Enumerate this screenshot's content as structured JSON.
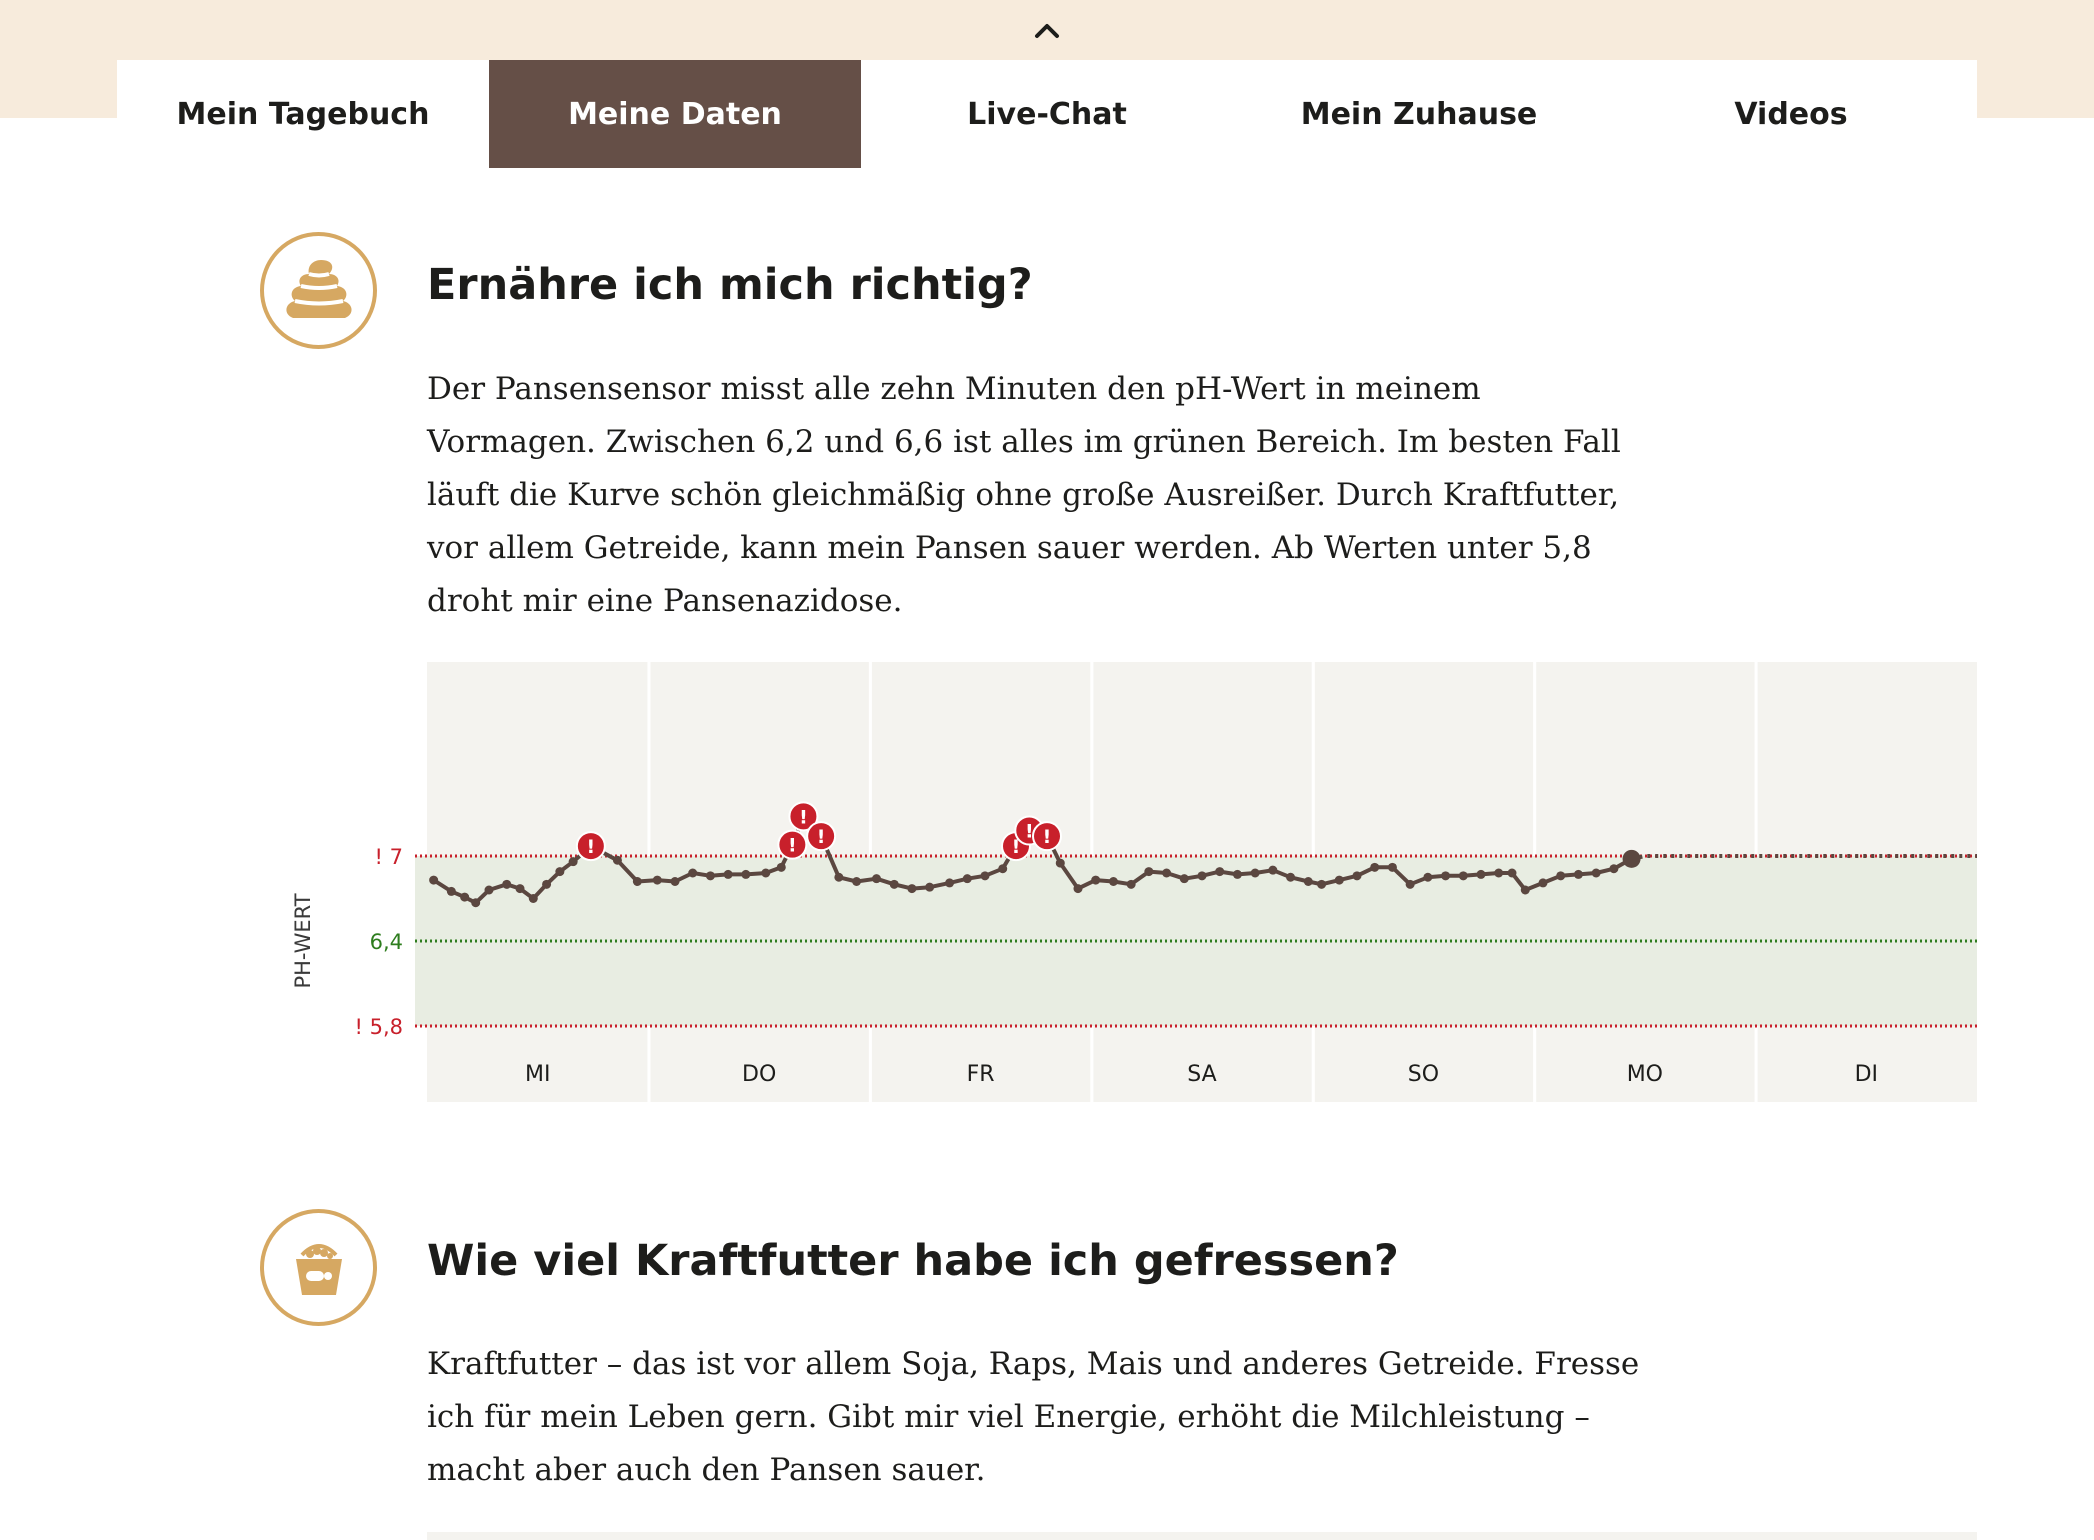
{
  "nav": {
    "tabs": [
      {
        "label": "Mein Tagebuch",
        "active": false
      },
      {
        "label": "Meine Daten",
        "active": true
      },
      {
        "label": "Live-Chat",
        "active": false
      },
      {
        "label": "Mein Zuhause",
        "active": false
      },
      {
        "label": "Videos",
        "active": false
      }
    ],
    "collapse_icon": "chevron-up-icon"
  },
  "colors": {
    "top_band": "#f7ebdc",
    "active_tab": "#654f47",
    "icon_ring": "#d6a862",
    "curve": "#5b4740",
    "alert": "#c8202b",
    "ok_zone": "#e8ede2",
    "ok_line": "#2e7d1e"
  },
  "sections": [
    {
      "icon": "dung-icon",
      "title": "Ernähre ich mich richtig?",
      "text_lines": [
        "Der Pansensensor misst alle zehn Minuten den pH-Wert in meinem",
        "Vormagen. Zwischen 6,2 und 6,6 ist alles im grünen Bereich. Im besten Fall",
        "läuft die Kurve schön gleichmäßig ohne große Ausreißer. Durch Kraftfutter,",
        "vor allem Getreide, kann mein Pansen sauer werden. Ab Werten unter 5,8",
        "droht mir eine Pansenazidose."
      ]
    },
    {
      "icon": "feed-bucket-icon",
      "title": "Wie viel Kraftfutter habe ich gefressen?",
      "text_lines": [
        "Kraftfutter – das ist vor allem Soja, Raps, Mais und anderes Getreide. Fresse",
        "ich für mein Leben gern. Gibt mir viel Energie, erhöht die Milchleistung –",
        "macht aber auch den Pansen sauer."
      ]
    }
  ],
  "chart_data": {
    "type": "line",
    "ylabel": "PH-WERT",
    "ylim": [
      5.8,
      7.0
    ],
    "reference_lines": [
      {
        "label": "! 7",
        "value": 7.0,
        "kind": "alert"
      },
      {
        "label": "6,4",
        "value": 6.4,
        "kind": "ok"
      },
      {
        "label": "! 5,8",
        "value": 5.8,
        "kind": "alert"
      }
    ],
    "green_zone": [
      5.8,
      7.0
    ],
    "categories": [
      "MI",
      "DO",
      "FR",
      "SA",
      "SO",
      "MO",
      "DI"
    ],
    "x_unit": "day index (0 = MI start, 7 = DI end)",
    "series": [
      {
        "values": [
          [
            0.03,
            6.83
          ],
          [
            0.11,
            6.75
          ],
          [
            0.17,
            6.71
          ],
          [
            0.22,
            6.67
          ],
          [
            0.28,
            6.76
          ],
          [
            0.36,
            6.8
          ],
          [
            0.42,
            6.77
          ],
          [
            0.48,
            6.7
          ],
          [
            0.54,
            6.8
          ],
          [
            0.6,
            6.89
          ],
          [
            0.66,
            6.96
          ],
          [
            0.74,
            7.07
          ],
          [
            0.86,
            6.97
          ],
          [
            0.95,
            6.82
          ],
          [
            1.04,
            6.83
          ],
          [
            1.12,
            6.82
          ],
          [
            1.2,
            6.88
          ],
          [
            1.28,
            6.86
          ],
          [
            1.36,
            6.87
          ],
          [
            1.44,
            6.87
          ],
          [
            1.53,
            6.88
          ],
          [
            1.6,
            6.92
          ],
          [
            1.65,
            7.08
          ],
          [
            1.7,
            7.28
          ],
          [
            1.78,
            7.14
          ],
          [
            1.86,
            6.85
          ],
          [
            1.94,
            6.82
          ],
          [
            2.03,
            6.84
          ],
          [
            2.11,
            6.8
          ],
          [
            2.19,
            6.77
          ],
          [
            2.27,
            6.78
          ],
          [
            2.36,
            6.81
          ],
          [
            2.44,
            6.84
          ],
          [
            2.52,
            6.86
          ],
          [
            2.6,
            6.91
          ],
          [
            2.66,
            7.07
          ],
          [
            2.72,
            7.18
          ],
          [
            2.8,
            7.14
          ],
          [
            2.86,
            6.95
          ],
          [
            2.94,
            6.77
          ],
          [
            3.02,
            6.83
          ],
          [
            3.1,
            6.82
          ],
          [
            3.18,
            6.8
          ],
          [
            3.26,
            6.89
          ],
          [
            3.34,
            6.88
          ],
          [
            3.42,
            6.84
          ],
          [
            3.5,
            6.86
          ],
          [
            3.58,
            6.89
          ],
          [
            3.66,
            6.87
          ],
          [
            3.74,
            6.88
          ],
          [
            3.82,
            6.9
          ],
          [
            3.9,
            6.85
          ],
          [
            3.98,
            6.82
          ],
          [
            4.04,
            6.8
          ],
          [
            4.12,
            6.83
          ],
          [
            4.2,
            6.86
          ],
          [
            4.28,
            6.92
          ],
          [
            4.36,
            6.92
          ],
          [
            4.44,
            6.8
          ],
          [
            4.52,
            6.85
          ],
          [
            4.6,
            6.86
          ],
          [
            4.68,
            6.86
          ],
          [
            4.76,
            6.87
          ],
          [
            4.84,
            6.88
          ],
          [
            4.9,
            6.88
          ],
          [
            4.96,
            6.76
          ],
          [
            5.04,
            6.81
          ],
          [
            5.12,
            6.86
          ],
          [
            5.2,
            6.87
          ],
          [
            5.28,
            6.88
          ],
          [
            5.36,
            6.91
          ],
          [
            5.44,
            6.98
          ]
        ]
      }
    ],
    "alerts": [
      {
        "x": 0.74,
        "y": 7.07
      },
      {
        "x": 1.65,
        "y": 7.08
      },
      {
        "x": 1.7,
        "y": 7.28
      },
      {
        "x": 1.78,
        "y": 7.14
      },
      {
        "x": 2.66,
        "y": 7.07
      },
      {
        "x": 2.72,
        "y": 7.18
      },
      {
        "x": 2.8,
        "y": 7.14
      }
    ],
    "current": {
      "x": 5.44,
      "y": 6.98
    },
    "projection": {
      "from_x": 5.44,
      "to_x": 7.0,
      "y": 7.0
    },
    "grid": true,
    "legend": "none"
  }
}
